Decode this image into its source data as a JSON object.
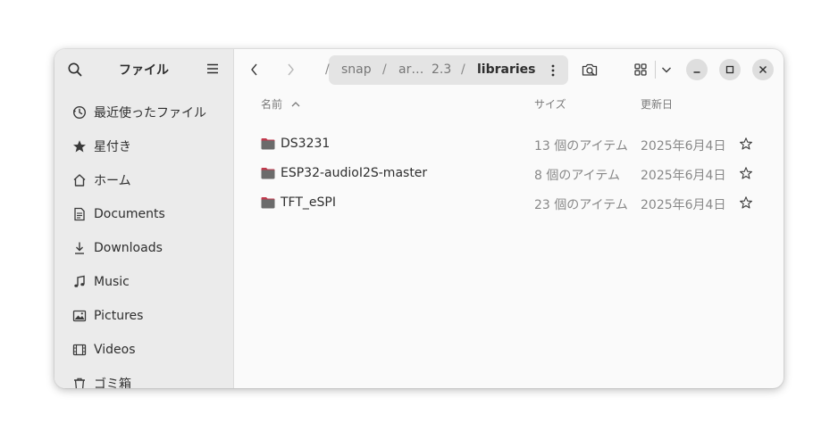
{
  "sidebar": {
    "title": "ファイル",
    "items": [
      {
        "label": "最近使ったファイル",
        "icon": "recent-icon"
      },
      {
        "label": "星付き",
        "icon": "star-icon"
      },
      {
        "label": "ホーム",
        "icon": "home-icon"
      },
      {
        "label": "Documents",
        "icon": "document-icon"
      },
      {
        "label": "Downloads",
        "icon": "download-icon"
      },
      {
        "label": "Music",
        "icon": "music-icon"
      },
      {
        "label": "Pictures",
        "icon": "picture-icon"
      },
      {
        "label": "Videos",
        "icon": "video-icon"
      },
      {
        "label": "ゴミ箱",
        "icon": "trash-icon"
      }
    ]
  },
  "path": {
    "segments": [
      "snap",
      "ar…",
      "2.3"
    ],
    "current": "libraries",
    "separator": "/"
  },
  "columns": {
    "name": "名前",
    "size": "サイズ",
    "date": "更新日"
  },
  "files": [
    {
      "name": "DS3231",
      "size": "13 個のアイテム",
      "date": "2025年6月4日"
    },
    {
      "name": "ESP32-audioI2S-master",
      "size": "8 個のアイテム",
      "date": "2025年6月4日"
    },
    {
      "name": "TFT_eSPI",
      "size": "23 個のアイテム",
      "date": "2025年6月4日"
    }
  ],
  "colors": {
    "folder": "#6b6b6b",
    "folder_tab": "#c2384c",
    "sidebar_bg": "#ebebeb",
    "path_bg": "#e4e4e4"
  }
}
